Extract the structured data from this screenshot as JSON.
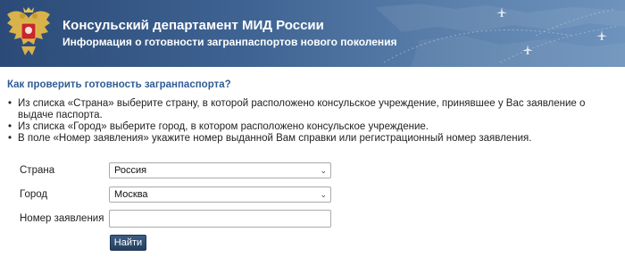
{
  "header": {
    "title": "Консульский департамент МИД России",
    "subtitle": "Информация о готовности загранпаспортов нового поколения"
  },
  "question": "Как проверить готовность загранпаспорта?",
  "instructions": [
    "Из списка «Страна» выберите страну, в которой расположено консульское учреждение, принявшее у Вас заявление о выдаче паспорта.",
    "Из списка «Город» выберите город, в котором расположено консульское учреждение.",
    "В поле «Номер заявления» укажите номер выданной Вам справки или регистрационный номер заявления."
  ],
  "form": {
    "country_label": "Страна",
    "country_value": "Россия",
    "city_label": "Город",
    "city_value": "Москва",
    "application_label": "Номер заявления",
    "application_value": "",
    "submit_label": "Найти"
  },
  "colors": {
    "header_bg": "#3f6493",
    "question_text": "#2f5d95",
    "button_bg": "#2e4b6e"
  }
}
